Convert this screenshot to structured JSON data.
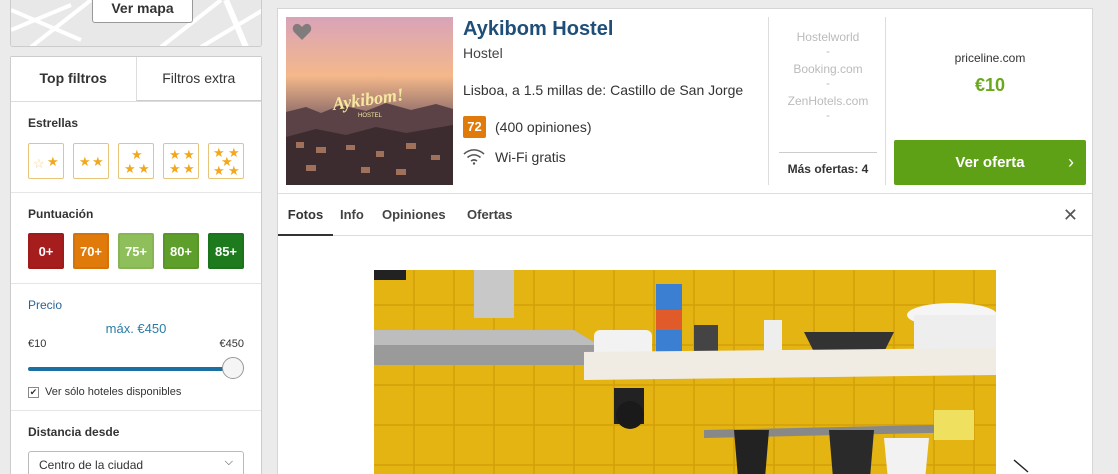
{
  "map": {
    "button_label": "Ver mapa"
  },
  "filters": {
    "tabs": [
      {
        "label": "Top filtros",
        "active": true
      },
      {
        "label": "Filtros extra",
        "active": false
      }
    ],
    "stars": {
      "title": "Estrellas",
      "options": [
        1,
        2,
        3,
        4,
        5
      ]
    },
    "rating": {
      "title": "Puntuación",
      "options": [
        {
          "label": "0+",
          "color": "#a61d1d"
        },
        {
          "label": "70+",
          "color": "#e07a0a"
        },
        {
          "label": "75+",
          "color": "#8fbf5a"
        },
        {
          "label": "80+",
          "color": "#5e9e2a"
        },
        {
          "label": "85+",
          "color": "#1d7a1d"
        }
      ]
    },
    "price": {
      "title": "Precio",
      "max_label": "máx. €450",
      "min": "€10",
      "max": "€450",
      "slider_fraction": 1.0,
      "available_only_label": "Ver sólo hoteles disponibles",
      "available_only_checked": true
    },
    "distance": {
      "title": "Distancia desde",
      "selected": "Centro de la ciudad"
    }
  },
  "hotel": {
    "name": "Aykibom Hostel",
    "type": "Hostel",
    "location": "Lisboa, a 1.5 millas de: Castillo de San Jorge",
    "score": "72",
    "reviews": "(400 opiniones)",
    "amenity": "Wi-Fi gratis",
    "thumb_sign": "Aykibom!",
    "thumb_sub": "HOSTEL",
    "other_sites": [
      {
        "name": "Hostelworld",
        "price": "-"
      },
      {
        "name": "Booking.com",
        "price": "-"
      },
      {
        "name": "ZenHotels.com",
        "price": "-"
      }
    ],
    "more_offers": "Más ofertas: 4",
    "best_deal": {
      "site": "priceline.com",
      "price": "€10",
      "button": "Ver oferta"
    },
    "detail_tabs": [
      "Fotos",
      "Info",
      "Opiniones",
      "Ofertas"
    ],
    "active_detail_tab": "Fotos"
  },
  "colors": {
    "accent_green": "#5fa116",
    "link_blue": "#1f4f78",
    "star": "#f2a81d"
  }
}
